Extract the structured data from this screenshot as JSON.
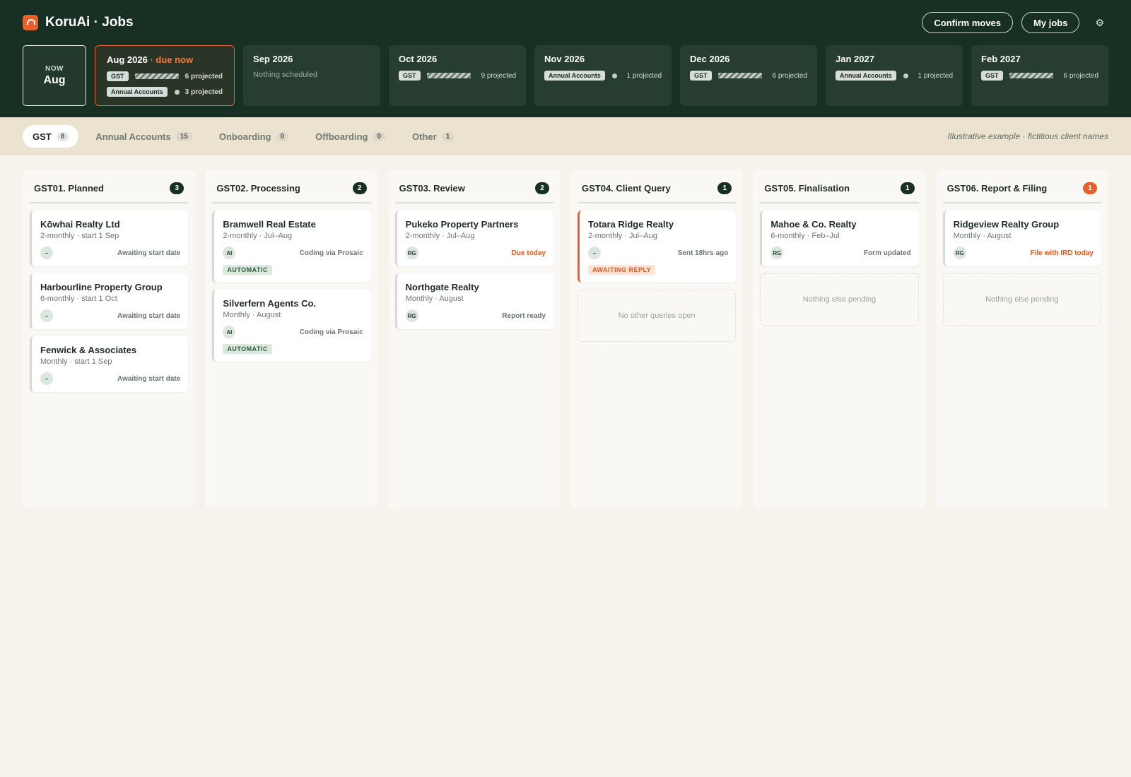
{
  "app": {
    "title": "KoruAi · Jobs"
  },
  "header": {
    "confirm_label": "Confirm moves",
    "myjobs_label": "My jobs",
    "settings_icon": "gear-icon"
  },
  "now": {
    "label": "NOW",
    "month": "Aug"
  },
  "months": [
    {
      "title": "Aug 2026",
      "due": " · due now",
      "rows": [
        {
          "tag": "GST",
          "bar": "stripes",
          "text": "6 projected"
        },
        {
          "tag": "Annual Accounts",
          "bar": "dot",
          "text": "3 projected"
        }
      ]
    },
    {
      "title": "Sep 2026",
      "note": "Nothing scheduled"
    },
    {
      "title": "Oct 2026",
      "rows": [
        {
          "tag": "GST",
          "bar": "stripes",
          "text": "9 projected"
        }
      ]
    },
    {
      "title": "Nov 2026",
      "rows": [
        {
          "tag": "Annual Accounts",
          "bar": "dot",
          "text": "1 projected"
        }
      ]
    },
    {
      "title": "Dec 2026",
      "rows": [
        {
          "tag": "GST",
          "bar": "stripes",
          "text": "6 projected"
        }
      ]
    },
    {
      "title": "Jan 2027",
      "rows": [
        {
          "tag": "Annual Accounts",
          "bar": "dot",
          "text": "1 projected"
        }
      ]
    },
    {
      "title": "Feb 2027",
      "rows": [
        {
          "tag": "GST",
          "bar": "stripes",
          "text": "6 projected"
        }
      ]
    }
  ],
  "tabs": [
    {
      "label": "GST",
      "count": "8"
    },
    {
      "label": "Annual Accounts",
      "count": "15"
    },
    {
      "label": "Onboarding",
      "count": "0"
    },
    {
      "label": "Offboarding",
      "count": "0"
    },
    {
      "label": "Other",
      "count": "1"
    }
  ],
  "disclaimer": "Illustrative example · fictitious client names",
  "colors": {
    "accent": "#e8602c",
    "dark": "#183023"
  },
  "columns": [
    {
      "title": "GST01. Planned",
      "count": "3",
      "cards": [
        {
          "name": "Kōwhai Realty Ltd",
          "sub": "2-monthly · start 1 Sep",
          "avatar": "–",
          "status": "Awaiting start date"
        },
        {
          "name": "Harbourline Property Group",
          "sub": "6-monthly · start 1 Oct",
          "avatar": "–",
          "status": "Awaiting start date"
        },
        {
          "name": "Fenwick & Associates",
          "sub": "Monthly · start 1 Sep",
          "avatar": "–",
          "status": "Awaiting start date"
        }
      ]
    },
    {
      "title": "GST02. Processing",
      "count": "2",
      "cards": [
        {
          "name": "Bramwell Real Estate",
          "sub": "2-monthly · Jul–Aug",
          "avatar": "AI",
          "status": "Coding via Prosaic",
          "badge": "AUTOMATIC"
        },
        {
          "name": "Silverfern Agents Co.",
          "sub": "Monthly · August",
          "avatar": "AI",
          "status": "Coding via Prosaic",
          "badge": "AUTOMATIC"
        }
      ]
    },
    {
      "title": "GST03. Review",
      "count": "2",
      "cards": [
        {
          "name": "Pukeko Property Partners",
          "sub": "2-monthly · Jul–Aug",
          "avatar": "RG",
          "status": "Due today",
          "warn": true
        },
        {
          "name": "Northgate Realty",
          "sub": "Monthly · August",
          "avatar": "RG",
          "status": "Report ready"
        }
      ]
    },
    {
      "title": "GST04. Client Query",
      "count": "1",
      "empty": "No other queries open",
      "cards": [
        {
          "name": "Totara Ridge Realty",
          "sub": "2-monthly · Jul–Aug",
          "avatar": "–",
          "status": "Sent 18hrs ago",
          "badge": "AWAITING REPLY",
          "urgent": true
        }
      ]
    },
    {
      "title": "GST05. Finalisation",
      "count": "1",
      "empty": "Nothing else pending",
      "cards": [
        {
          "name": "Mahoe & Co. Realty",
          "sub": "6-monthly · Feb–Jul",
          "avatar": "RG",
          "status": "Form updated"
        }
      ]
    },
    {
      "title": "GST06. Report & Filing",
      "count": "1",
      "alert": true,
      "empty": "Nothing else pending",
      "cards": [
        {
          "name": "Ridgeview Realty Group",
          "sub": "Monthly · August",
          "avatar": "RG",
          "status": "File with IRD today",
          "warn": true
        }
      ]
    }
  ]
}
